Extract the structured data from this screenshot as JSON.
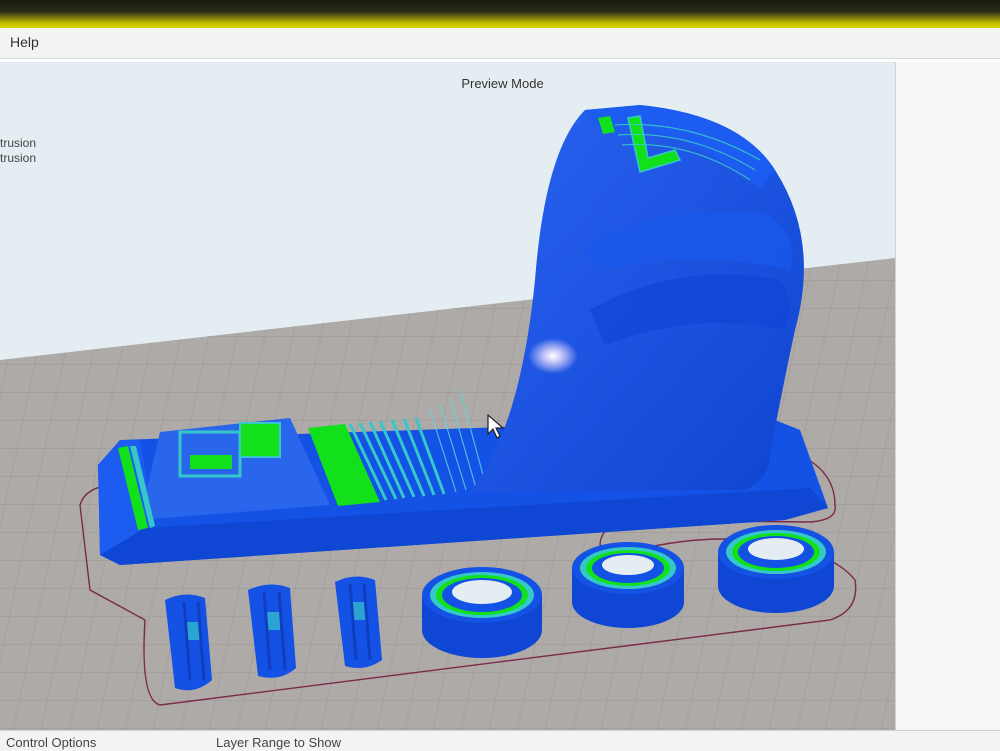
{
  "menu": {
    "help": "Help"
  },
  "viewport": {
    "title": "Preview Mode",
    "legend": [
      "trusion",
      "trusion"
    ]
  },
  "bottom": {
    "control_options": "Control Options",
    "layer_range": "Layer Range to Show"
  },
  "colors": {
    "model_blue": "#1452e6",
    "infill_green": "#12e01a",
    "perimeter_cyan": "#36c8c8",
    "skirt": "#7a2a4a",
    "bed": "#aeaaa8"
  }
}
